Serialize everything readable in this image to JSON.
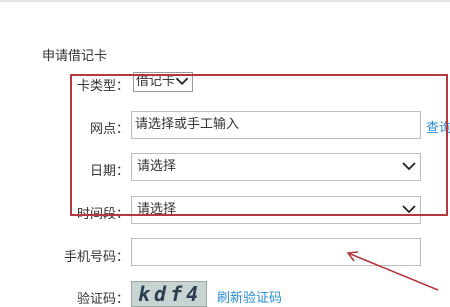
{
  "form": {
    "title": "申请借记卡",
    "card_type": {
      "label": "卡类型：",
      "value": "借记卡"
    },
    "branch": {
      "label": "网点：",
      "placeholder": "请选择或手工输入",
      "query_link": "查询"
    },
    "date": {
      "label": "日期：",
      "value": "请选择"
    },
    "time_slot": {
      "label": "时间段：",
      "value": "请选择"
    },
    "phone": {
      "label": "手机号码：",
      "value": ""
    },
    "captcha": {
      "label": "验证码：",
      "code": "kdf4",
      "refresh_link": "刷新验证码"
    }
  },
  "annotation": {
    "box_color": "#b5383f",
    "arrow_color": "#b5383f"
  },
  "colors": {
    "link": "#2a8bd6",
    "captcha_bg": "#c7d4d1"
  }
}
